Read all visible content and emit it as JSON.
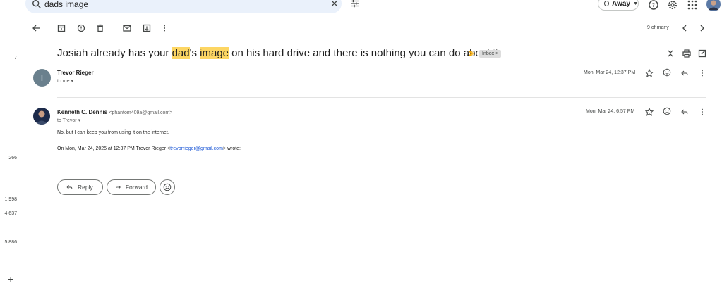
{
  "search": {
    "query": "dads image"
  },
  "status": {
    "label": "Away"
  },
  "rail": {
    "counts": [
      "7",
      "266",
      "1,998",
      "4,637",
      "5,886"
    ],
    "add": "+"
  },
  "pagination": {
    "text": "9 of many"
  },
  "subject": {
    "part1": "Josiah already has your ",
    "highlight1": "dad",
    "part2": "'s ",
    "highlight2": "image",
    "part3": " on his hard drive and there is nothing you can do about it.",
    "label": "Inbox ×"
  },
  "messages": [
    {
      "avatar_letter": "T",
      "sender": "Trevor Rieger",
      "to": "to me ▾",
      "date": "Mon, Mar 24, 12:37 PM"
    },
    {
      "sender": "Kenneth C. Dennis",
      "address": "<phantom409a@gmail.com>",
      "to": "to Trevor ▾",
      "date": "Mon, Mar 24, 6:57 PM",
      "body": "No, but I can keep you from using it on the internet.",
      "quote_prefix": "On Mon, Mar 24, 2025 at 12:37 PM Trevor Rieger <",
      "quote_link": "trevorrieger@gmail.com",
      "quote_suffix": "> wrote:"
    }
  ],
  "actions": {
    "reply": "Reply",
    "forward": "Forward"
  },
  "colors": {
    "highlight": "#fdd663",
    "search_bg": "#eaf1fb",
    "link": "#1a56d6",
    "avatar": "#6a808d"
  }
}
